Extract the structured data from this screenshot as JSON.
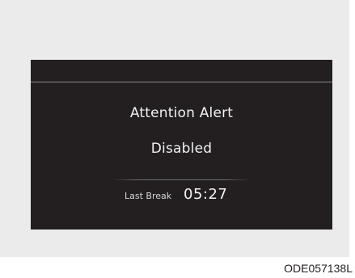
{
  "display": {
    "title": "Attention Alert",
    "status": "Disabled",
    "last_break_label": "Last Break",
    "last_break_time": "05:27"
  },
  "footer": {
    "code": "ODE057138L"
  },
  "colors": {
    "panel_background": "#ebebeb",
    "screen_background": "#231f20",
    "screen_text": "#f2f2f2"
  }
}
